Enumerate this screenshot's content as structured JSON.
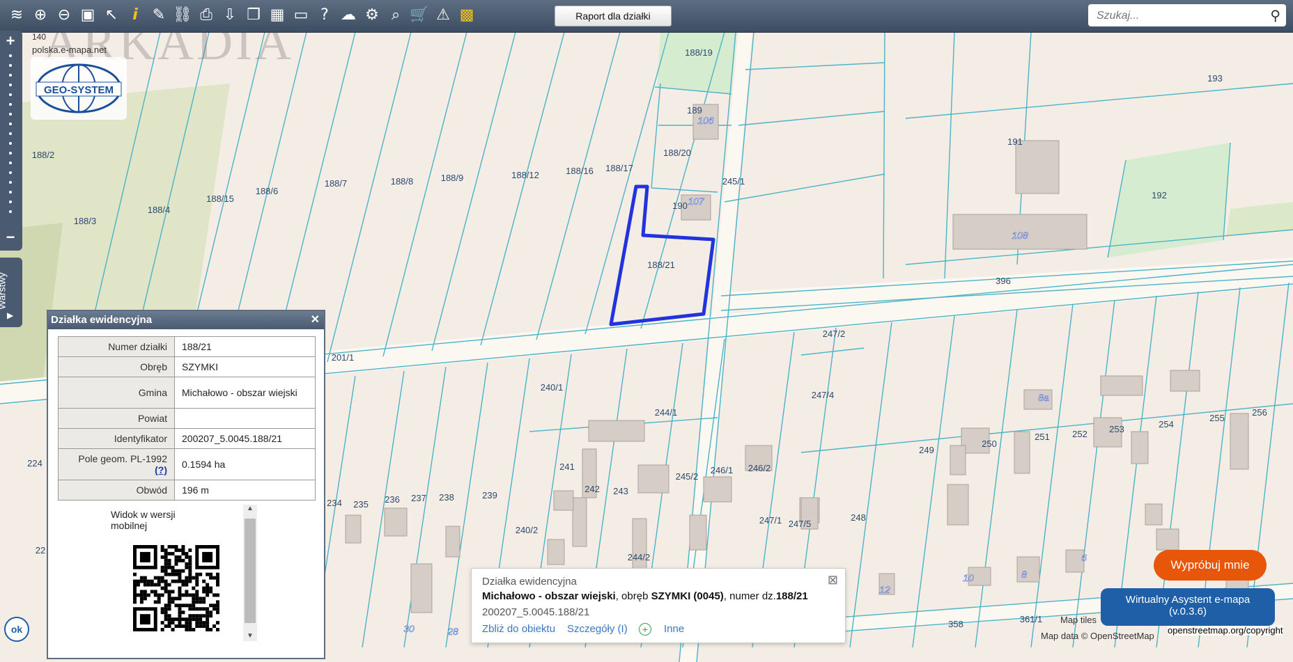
{
  "toolbar": {
    "icons": [
      "layers-icon",
      "zoom-in-icon",
      "zoom-out-icon",
      "full-extent-icon",
      "select-icon",
      "info-icon",
      "measure-icon",
      "link-icon",
      "print-icon",
      "download-icon",
      "copy-icon",
      "layout-icon",
      "comment-icon",
      "help-icon",
      "cloud-icon",
      "settings-icon",
      "search-map-icon",
      "cart-icon",
      "warning-icon",
      "color-palette-icon"
    ],
    "report_label": "Raport dla działki"
  },
  "search": {
    "placeholder": "Szukaj..."
  },
  "watermark": {
    "text": "ARKADIA",
    "site": "polska.e-mapa.net",
    "scale_number": "140"
  },
  "logo": {
    "text": "GEO-SYSTEM"
  },
  "layers_tab": {
    "label": "Warstwy"
  },
  "info_panel": {
    "title": "Działka ewidencyjna",
    "rows": [
      {
        "key": "Numer działki",
        "value": "188/21"
      },
      {
        "key": "Obręb",
        "value": "SZYMKI"
      },
      {
        "key": "Gmina",
        "value": "Michałowo - obszar wiejski"
      },
      {
        "key": "Powiat",
        "value": ""
      },
      {
        "key": "Identyfikator",
        "value": "200207_5.0045.188/21"
      },
      {
        "key": "Pole geom. PL-1992",
        "help": "(?)",
        "value": "0.1594 ha"
      },
      {
        "key": "Obwód",
        "value": "196 m"
      }
    ],
    "mobile_label": "Widok w wersji mobilnej"
  },
  "popup": {
    "title": "Działka ewidencyjna",
    "gmina": "Michałowo - obszar wiejski",
    "mid1": ", obręb ",
    "obreb": "SZYMKI (0045)",
    "mid2": ", numer dz.",
    "numer": "188/21",
    "identifier": "200207_5.0045.188/21",
    "link_zoom": "Zbliż do obiektu",
    "link_details": "Szczegóły (I)",
    "link_other": "Inne"
  },
  "assistant": {
    "try_label": "Wypróbuj mnie",
    "name": "Wirtualny Asystent e-mapa",
    "version": "(v.0.3.6)"
  },
  "attribution": {
    "tiles": "Map tiles",
    "data": "Map data © OpenStreetMap",
    "copyright": "openstreetmap.org/copyright",
    "map_suffix": "Map"
  },
  "ok_label": "ok",
  "parcel_labels": [
    "188/19",
    "189",
    "188/20",
    "191",
    "193",
    "192",
    "188/2",
    "188/15",
    "188/6",
    "188/7",
    "188/8",
    "188/9",
    "188/12",
    "188/16",
    "188/17",
    "190",
    "245/1",
    "188/3",
    "188/4",
    "188/21",
    "396",
    "247/2",
    "201/1",
    "240/1",
    "247/4",
    "244/1",
    "240/2",
    "241",
    "242",
    "243",
    "245/2",
    "246/1",
    "246/2",
    "247/1",
    "247/5",
    "248",
    "249",
    "250",
    "251",
    "252",
    "253",
    "254",
    "255",
    "256",
    "224",
    "22",
    "234",
    "235",
    "236",
    "237",
    "238",
    "239",
    "244/2",
    "358",
    "361/1"
  ],
  "building_labels": [
    "106",
    "107",
    "108",
    "8a",
    "6",
    "10",
    "8",
    "12",
    "30",
    "28"
  ]
}
